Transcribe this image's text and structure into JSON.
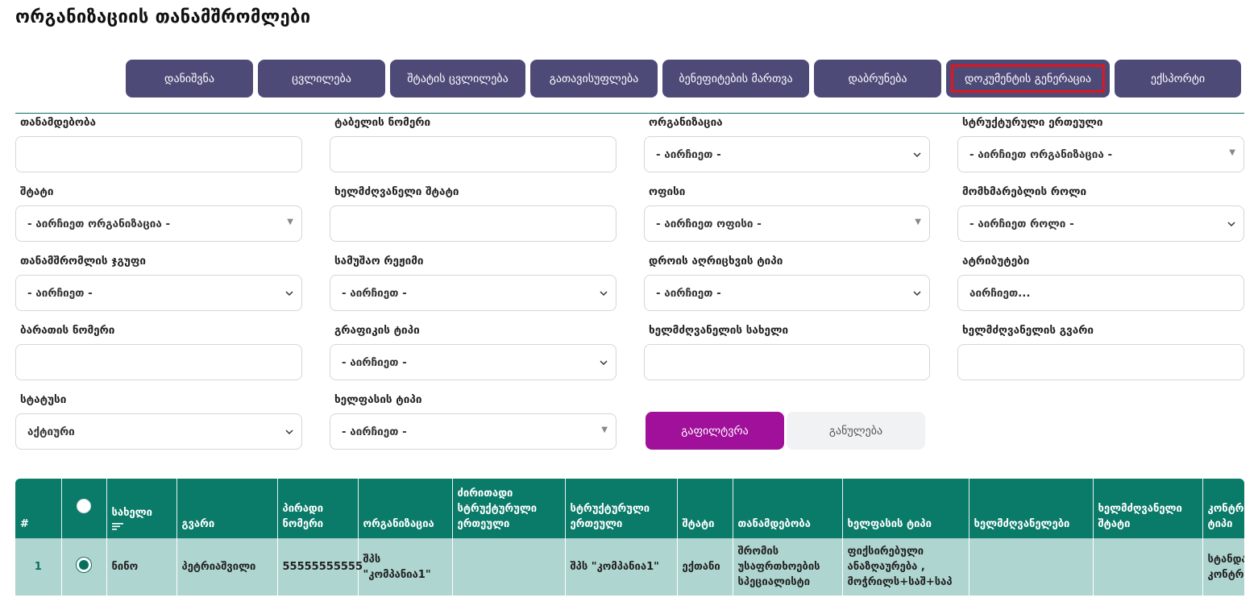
{
  "page": {
    "title": "ორგანიზაციის თანამშრომლები"
  },
  "actions": [
    {
      "label": "დანიშვნა"
    },
    {
      "label": "ცვლილება"
    },
    {
      "label": "შტატის ცვლილება"
    },
    {
      "label": "გათავისუფლება"
    },
    {
      "label": "ბენეფიტების მართვა"
    },
    {
      "label": "დაბრუნება"
    },
    {
      "label": "დოკუმენტის გენერაცია"
    },
    {
      "label": "ექსპორტი"
    }
  ],
  "filters": {
    "position": {
      "label": "თანამდებობა",
      "value": ""
    },
    "tabel_number": {
      "label": "ტაბელის ნომერი",
      "value": ""
    },
    "organization": {
      "label": "ორგანიზაცია",
      "value": "- აირჩიეთ -"
    },
    "structural_unit": {
      "label": "სტრუქტურული ერთეული",
      "value": "- აირჩიეთ ორგანიზაცია -"
    },
    "shtat": {
      "label": "შტატი",
      "value": "- აირჩიეთ ორგანიზაცია -"
    },
    "manager_shtat": {
      "label": "ხელმძღვანელი შტატი",
      "value": ""
    },
    "office": {
      "label": "ოფისი",
      "value": "- აირჩიეთ ოფისი -"
    },
    "user_role": {
      "label": "მომხმარებლის როლი",
      "value": "- აირჩიეთ როლი -"
    },
    "employee_group": {
      "label": "თანამშრომლის ჯგუფი",
      "value": "- აირჩიეთ -"
    },
    "work_regime": {
      "label": "სამუშაო რეჟიმი",
      "value": "- აირჩიეთ -"
    },
    "time_tracking_type": {
      "label": "დროის აღრიცხვის ტიპი",
      "value": "- აირჩიეთ -"
    },
    "attributes": {
      "label": "ატრიბუტები",
      "value": "აირჩიეთ..."
    },
    "card_number": {
      "label": "ბარათის ნომერი",
      "value": ""
    },
    "schedule_type": {
      "label": "გრაფიკის ტიპი",
      "value": "- აირჩიეთ -"
    },
    "manager_name": {
      "label": "ხელმძღვანელის სახელი",
      "value": ""
    },
    "manager_surname": {
      "label": "ხელმძღვანელის გვარი",
      "value": ""
    },
    "status": {
      "label": "სტატუსი",
      "value": "აქტიური"
    },
    "salary_type": {
      "label": "ხელფასის ტიპი",
      "value": "- აირჩიეთ -"
    }
  },
  "filter_button": "გაფილტვრა",
  "reset_button": "განულება",
  "table": {
    "columns": [
      "#",
      "",
      "სახელი",
      "გვარი",
      "პირადი ნომერი",
      "ორგანიზაცია",
      "ძირითადი სტრუქტურული ერთეული",
      "სტრუქტურული ერთეული",
      "შტატი",
      "თანამდებობა",
      "ხელფასის ტიპი",
      "ხელმძღვანელები",
      "ხელმძღვანელი შტატი",
      "კონტრაქტის ტიპი"
    ],
    "rows": [
      {
        "num": "1",
        "first_name": "ნინო",
        "last_name": "პეტრიაშვილი",
        "personal_id": "55555555555",
        "organization": "შპს \"კომპანია1\"",
        "main_unit": "",
        "unit": "შპს \"კომპანია1\"",
        "shtat": "ექთანი",
        "position": "შრომის უსაფრთხოების სპეციალისტი",
        "salary_type": "ფიქსირებული ანაზღაურება , მოჭრილს+საშ+საპ",
        "managers": "",
        "manager_shtat": "",
        "contract_type": "სტანდარტული კონტრაქტი"
      }
    ]
  }
}
